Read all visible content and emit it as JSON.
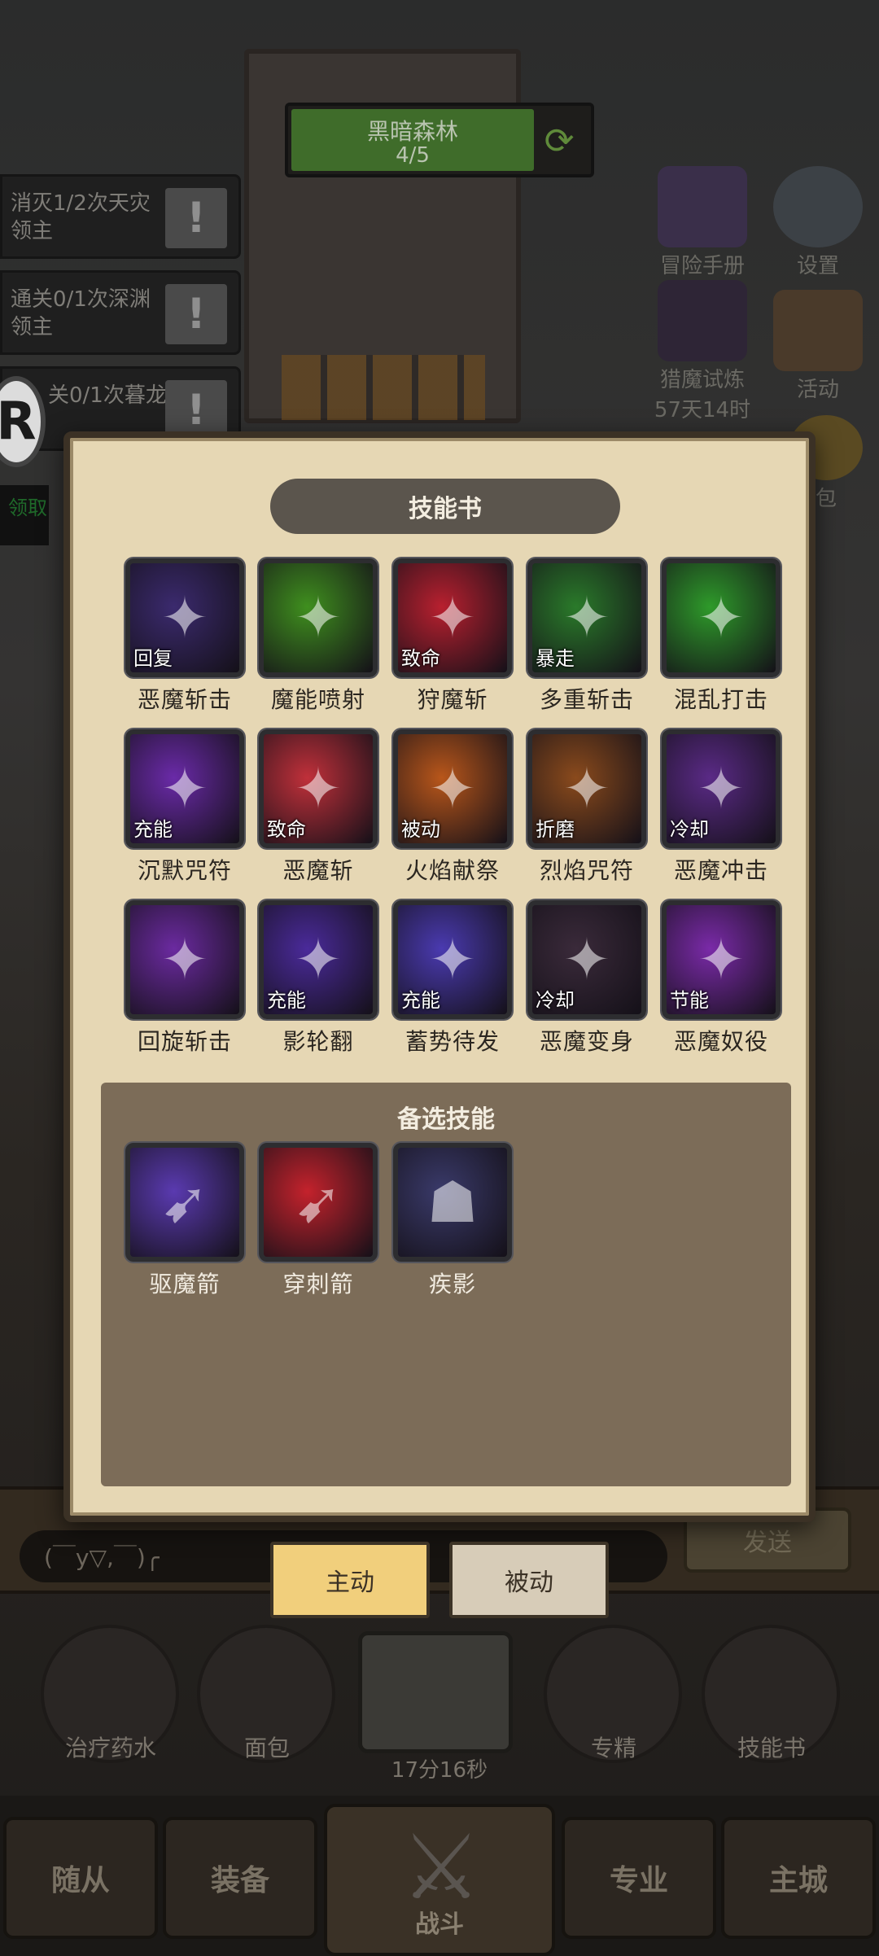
{
  "stage": {
    "title": "黑暗森林",
    "progress": "4/5"
  },
  "quests": [
    {
      "text": "消灭1/2次天灾领主"
    },
    {
      "text": "通关0/1次深渊领主"
    },
    {
      "text": "关0/1次暮龙"
    }
  ],
  "claim_text": "领取",
  "side_buttons": {
    "adventure_manual": "冒险手册",
    "settings": "设置",
    "demon_trial": "猎魔试炼",
    "demon_trial_timer": "57天14时",
    "activity": "活动",
    "bag": "包"
  },
  "modal": {
    "title": "技能书",
    "skills": [
      {
        "name": "恶魔斩击",
        "tag": "回复",
        "color": "#3b2a6e"
      },
      {
        "name": "魔能喷射",
        "tag": "",
        "color": "#3f8f1e"
      },
      {
        "name": "狩魔斩",
        "tag": "致命",
        "color": "#b8202f"
      },
      {
        "name": "多重斩击",
        "tag": "暴走",
        "color": "#2a7a2a"
      },
      {
        "name": "混乱打击",
        "tag": "",
        "color": "#2e9a2a"
      },
      {
        "name": "沉默咒符",
        "tag": "充能",
        "color": "#6a2aa8"
      },
      {
        "name": "恶魔斩",
        "tag": "致命",
        "color": "#c0303a"
      },
      {
        "name": "火焰献祭",
        "tag": "被动",
        "color": "#b8561a"
      },
      {
        "name": "烈焰咒符",
        "tag": "折磨",
        "color": "#8a4a1c"
      },
      {
        "name": "恶魔冲击",
        "tag": "冷却",
        "color": "#5a2a86"
      },
      {
        "name": "回旋斩击",
        "tag": "",
        "color": "#6b2aa0"
      },
      {
        "name": "影轮翻",
        "tag": "充能",
        "color": "#4a2a9a"
      },
      {
        "name": "蓄势待发",
        "tag": "充能",
        "color": "#4a3ab0"
      },
      {
        "name": "恶魔变身",
        "tag": "冷却",
        "color": "#3a2a3a"
      },
      {
        "name": "恶魔奴役",
        "tag": "节能",
        "color": "#7a2aa8"
      }
    ],
    "reserve_title": "备选技能",
    "reserve_skills": [
      {
        "name": "驱魔箭",
        "tag": "",
        "color": "#5a3ab0"
      },
      {
        "name": "穿刺箭",
        "tag": "",
        "color": "#c4222c"
      },
      {
        "name": "疾影",
        "tag": "",
        "color": "#3a3a6a"
      }
    ]
  },
  "tabs": {
    "active": "主动",
    "passive": "被动"
  },
  "chat": {
    "placeholder": "(￣y▽,￣)╭",
    "send": "发送"
  },
  "quickbar": {
    "potion": "治疗药水",
    "bread": "面包",
    "chest_timer": "17分16秒",
    "mastery": "专精",
    "skillbook": "技能书"
  },
  "nav": {
    "followers": "随从",
    "equipment": "装备",
    "battle": "战斗",
    "profession": "专业",
    "main_city": "主城"
  }
}
